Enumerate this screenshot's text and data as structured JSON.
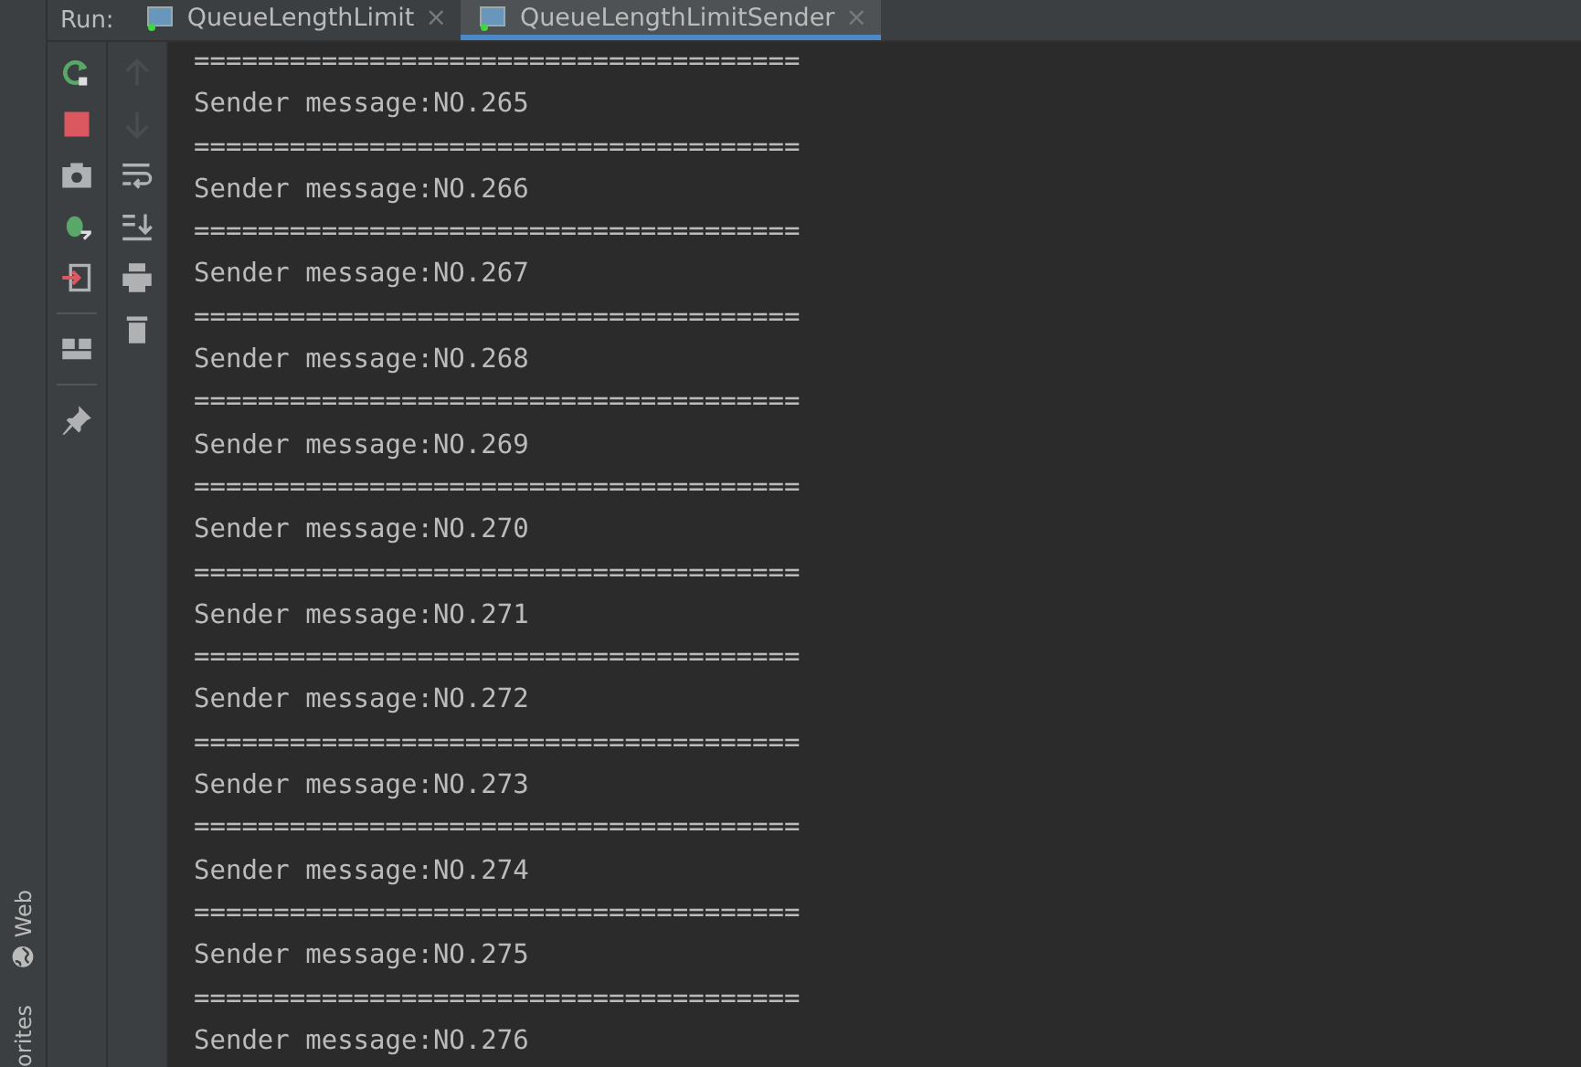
{
  "run_label": "Run:",
  "tabs": [
    {
      "label": "QueueLengthLimit",
      "close": "×",
      "selected": false
    },
    {
      "label": "QueueLengthLimitSender",
      "close": "×",
      "selected": true
    }
  ],
  "left_stripe": [
    {
      "label": "Web",
      "kind": "web"
    },
    {
      "label": "orites",
      "kind": "plain"
    }
  ],
  "toolbar_main": [
    {
      "kind": "rerun",
      "disabled": false
    },
    {
      "kind": "stop",
      "disabled": false
    },
    {
      "kind": "camera",
      "disabled": false
    },
    {
      "kind": "debug",
      "disabled": false
    },
    {
      "kind": "exit",
      "disabled": false
    },
    {
      "kind": "sep"
    },
    {
      "kind": "layout",
      "disabled": false
    },
    {
      "kind": "sep"
    },
    {
      "kind": "pin",
      "disabled": false
    }
  ],
  "toolbar_side": [
    {
      "kind": "up",
      "disabled": true
    },
    {
      "kind": "down",
      "disabled": true
    },
    {
      "kind": "wrap",
      "disabled": false
    },
    {
      "kind": "scroll",
      "disabled": false
    },
    {
      "kind": "print",
      "disabled": false
    },
    {
      "kind": "trash",
      "disabled": false
    }
  ],
  "console_lines": [
    "======================================",
    "Sender message:NO.265",
    "======================================",
    "Sender message:NO.266",
    "======================================",
    "Sender message:NO.267",
    "======================================",
    "Sender message:NO.268",
    "======================================",
    "Sender message:NO.269",
    "======================================",
    "Sender message:NO.270",
    "======================================",
    "Sender message:NO.271",
    "======================================",
    "Sender message:NO.272",
    "======================================",
    "Sender message:NO.273",
    "======================================",
    "Sender message:NO.274",
    "======================================",
    "Sender message:NO.275",
    "======================================",
    "Sender message:NO.276"
  ]
}
